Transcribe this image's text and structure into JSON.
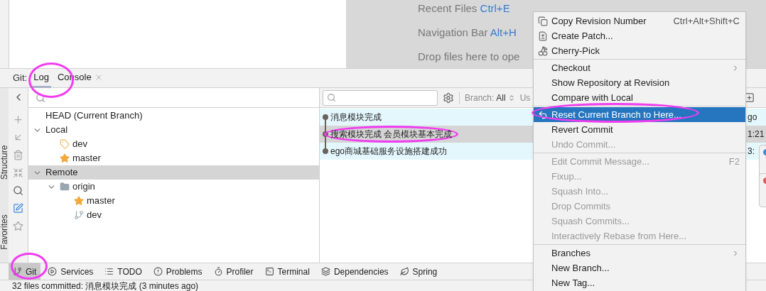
{
  "welcome": {
    "hints": [
      {
        "label": "Recent Files",
        "shortcut": "Ctrl+E"
      },
      {
        "label": "Navigation Bar",
        "shortcut": "Alt+H"
      },
      {
        "label": "Drop files here to ope"
      }
    ]
  },
  "side_tabs": [
    {
      "label": "Structure"
    },
    {
      "label": "Favorites"
    }
  ],
  "tool_window": {
    "label": "Git:",
    "tabs": [
      {
        "label": "Log",
        "selected": true,
        "closable": false
      },
      {
        "label": "Console",
        "selected": false,
        "closable": true
      }
    ]
  },
  "branches": {
    "items": [
      {
        "label": "HEAD (Current Branch)",
        "selected": false
      },
      {
        "label": "Local",
        "expanded": true,
        "selected": false,
        "children": [
          {
            "label": "dev",
            "kind": "tag",
            "selected": false
          },
          {
            "label": "master",
            "kind": "star",
            "selected": false
          }
        ]
      },
      {
        "label": "Remote",
        "expanded": true,
        "selected": true,
        "children": [
          {
            "label": "origin",
            "kind": "folder",
            "expanded": true,
            "selected": false,
            "children": [
              {
                "label": "master",
                "kind": "star",
                "selected": false
              },
              {
                "label": "dev",
                "kind": "branch",
                "selected": false
              }
            ]
          }
        ]
      }
    ]
  },
  "log": {
    "branch_filter": {
      "label": "Branch:",
      "value": "All"
    },
    "user_filter": "Us",
    "commits": [
      {
        "message": "消息模块完成",
        "time": "go",
        "selected": false
      },
      {
        "message": "搜索模块完成 会员模块基本完成",
        "time": "1:21",
        "selected": true
      },
      {
        "message": "ego商城基础服务设施搭建成功",
        "time": "3:",
        "selected": false
      }
    ]
  },
  "menu": {
    "items": [
      {
        "kind": "item",
        "label": "Copy Revision Number",
        "shortcut": "Ctrl+Alt+Shift+C",
        "disabled": false,
        "highlighted": false,
        "submenu": false
      },
      {
        "kind": "item",
        "label": "Create Patch...",
        "disabled": false,
        "highlighted": false,
        "submenu": false
      },
      {
        "kind": "item",
        "label": "Cherry-Pick",
        "disabled": false,
        "highlighted": false,
        "submenu": false
      },
      {
        "kind": "separator"
      },
      {
        "kind": "item",
        "label": "Checkout",
        "disabled": false,
        "highlighted": false,
        "submenu": true
      },
      {
        "kind": "item",
        "label": "Show Repository at Revision",
        "disabled": false,
        "highlighted": false,
        "submenu": false
      },
      {
        "kind": "item",
        "label": "Compare with Local",
        "disabled": false,
        "highlighted": false,
        "submenu": false
      },
      {
        "kind": "separator"
      },
      {
        "kind": "item",
        "label": "Reset Current Branch to Here...",
        "disabled": false,
        "highlighted": true,
        "submenu": false
      },
      {
        "kind": "item",
        "label": "Revert Commit",
        "disabled": false,
        "highlighted": false,
        "submenu": false
      },
      {
        "kind": "item",
        "label": "Undo Commit...",
        "disabled": true,
        "highlighted": false,
        "submenu": false
      },
      {
        "kind": "separator"
      },
      {
        "kind": "item",
        "label": "Edit Commit Message...",
        "shortcut": "F2",
        "disabled": true,
        "highlighted": false,
        "submenu": false
      },
      {
        "kind": "item",
        "label": "Fixup...",
        "disabled": true,
        "highlighted": false,
        "submenu": false
      },
      {
        "kind": "item",
        "label": "Squash Into...",
        "disabled": true,
        "highlighted": false,
        "submenu": false
      },
      {
        "kind": "item",
        "label": "Drop Commits",
        "disabled": true,
        "highlighted": false,
        "submenu": false
      },
      {
        "kind": "item",
        "label": "Squash Commits...",
        "disabled": true,
        "highlighted": false,
        "submenu": false
      },
      {
        "kind": "item",
        "label": "Interactively Rebase from Here...",
        "disabled": true,
        "highlighted": false,
        "submenu": false
      },
      {
        "kind": "separator"
      },
      {
        "kind": "item",
        "label": "Branches",
        "disabled": false,
        "highlighted": false,
        "submenu": true
      },
      {
        "kind": "item",
        "label": "New Branch...",
        "disabled": false,
        "highlighted": false,
        "submenu": false
      },
      {
        "kind": "item",
        "label": "New Tag...",
        "disabled": false,
        "highlighted": false,
        "submenu": false
      }
    ]
  },
  "bottom_tabs": [
    {
      "label": "Git",
      "selected": true
    },
    {
      "label": "Services",
      "selected": false
    },
    {
      "label": "TODO",
      "selected": false
    },
    {
      "label": "Problems",
      "selected": false
    },
    {
      "label": "Profiler",
      "selected": false
    },
    {
      "label": "Terminal",
      "selected": false
    },
    {
      "label": "Dependencies",
      "selected": false
    },
    {
      "label": "Spring",
      "selected": false
    }
  ],
  "status": {
    "text": "32 files committed: 消息模块完成 (3 minutes ago)"
  },
  "notifications": [
    {
      "color": "#3a8fd6"
    },
    {
      "color": "#e05a5a"
    }
  ]
}
